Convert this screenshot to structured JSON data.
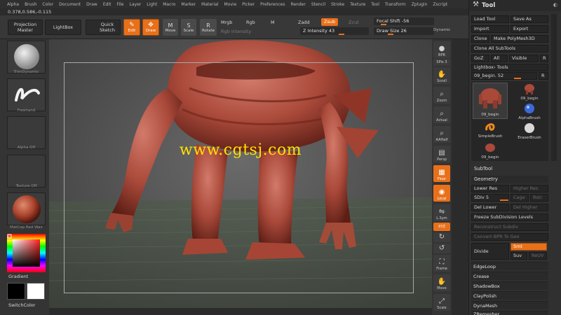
{
  "menu": [
    "Alpha",
    "Brush",
    "Color",
    "Document",
    "Draw",
    "Edit",
    "File",
    "Layer",
    "Light",
    "Macro",
    "Marker",
    "Material",
    "Movie",
    "Picker",
    "Preferences",
    "Render",
    "Stencil",
    "Stroke",
    "Texture",
    "Tool",
    "Transform",
    "Zplugin",
    "Zscript"
  ],
  "coords": "0.378,0.586,-0.115",
  "toolbar": {
    "projection_master": "Projection Master",
    "lightbox": "LightBox",
    "quick_sketch": "Quick Sketch",
    "edit": "Edit",
    "draw": "Draw",
    "move": "Move",
    "scale": "Scale",
    "rotate": "Rotate",
    "mrgb": "Mrgb",
    "rgb": "Rgb",
    "m": "M",
    "rgb_intensity": "Rgb Intensity",
    "zadd": "Zadd",
    "zsub": "Zsub",
    "zcut": "Zcut",
    "z_intensity": "Z Intensity 43",
    "focal_shift": "Focal Shift -56",
    "draw_size": "Draw Size 26",
    "dynamic": "Dynamic"
  },
  "left": {
    "brush1": "TrimDynamic",
    "brush2": "Freehand",
    "alpha": "Alpha Off",
    "texture": "Texture Off",
    "material": "MatCap Red Wax",
    "gradient": "Gradient",
    "switch_color": "SwitchColor"
  },
  "viewport": {
    "watermark": "www.cgtsj.com"
  },
  "right_shelf": [
    {
      "label": "BPR",
      "icon": "sphere-icon"
    },
    {
      "label": "SPix 3",
      "icon": ""
    },
    {
      "label": "Scroll",
      "icon": "hand-icon"
    },
    {
      "label": "Zoom",
      "icon": "magnifier-icon"
    },
    {
      "label": "Actual",
      "icon": "magnifier-icon"
    },
    {
      "label": "AAHalf",
      "icon": "magnifier-icon"
    },
    {
      "label": "Persp",
      "icon": "persp-icon"
    },
    {
      "label": "Floor",
      "icon": "floor-icon"
    },
    {
      "label": "Local",
      "icon": "local-icon"
    },
    {
      "label": "L.Sym",
      "icon": "sym-icon"
    },
    {
      "label": "XYZ",
      "icon": "xyz-icon"
    },
    {
      "label": "Frame",
      "icon": "frame-icon"
    },
    {
      "label": "Move",
      "icon": "hand-icon"
    },
    {
      "label": "Scale",
      "icon": "scale-icon"
    }
  ],
  "palette": {
    "title": "Tool",
    "load_tool": "Load Tool",
    "save_as": "Save As",
    "import": "Import",
    "export": "Export",
    "clone": "Clone",
    "make_polymesh": "Make PolyMesh3D",
    "clone_all": "Clone All SubTools",
    "goz": "GoZ",
    "all": "All",
    "visible": "Visible",
    "r": "R",
    "lightbox_tools": "Lightbox› Tools",
    "current_tool": "09_begin. 52",
    "thumbs": [
      "09_begin",
      "09_begin",
      "AlphaBrush",
      "SimpleBrush",
      "EraserBrush",
      "09_begin"
    ],
    "subtool": "SubTool",
    "geometry": "Geometry",
    "lower_res": "Lower Res",
    "higher_res": "Higher Res",
    "sdiv": "SDiv 5",
    "cage": "Cage",
    "rstr": "Rstr",
    "del_lower": "Del Lower",
    "del_higher": "Del Higher",
    "freeze": "Freeze SubDivision Levels",
    "reconstruct": "Reconstruct Subdiv",
    "convert_bpr": "Convert BPR To Geo",
    "divide": "Divide",
    "smt": "Smt",
    "suv": "Suv",
    "reuv": "ReUV",
    "edgeloop": "EdgeLoop",
    "crease": "Crease",
    "shadowbox": "ShadowBox",
    "claypolish": "ClayPolish",
    "dynamesh": "DynaMesh",
    "zremesher": "ZRemesher"
  }
}
